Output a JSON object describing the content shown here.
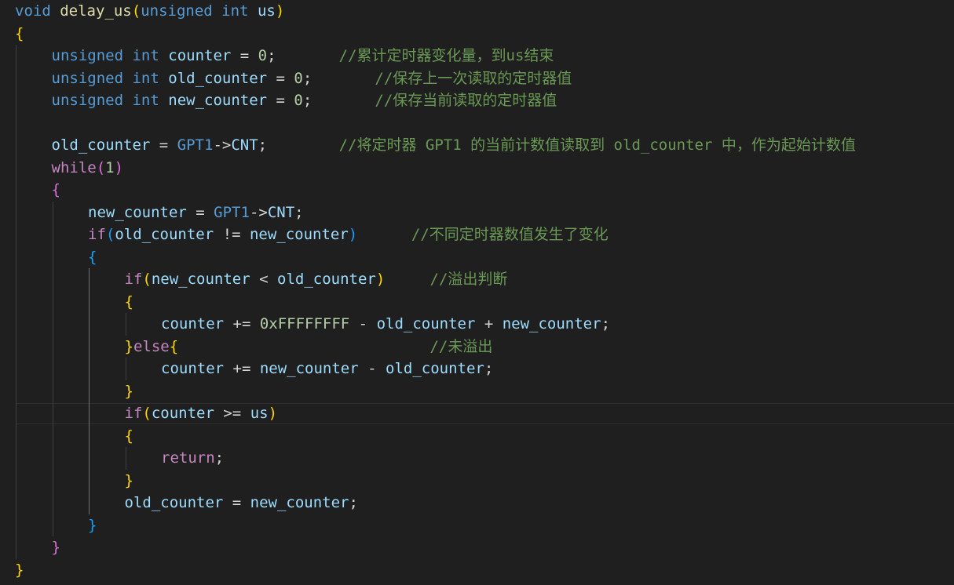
{
  "colors": {
    "background": "#1f1f1f",
    "keyword": "#569cd6",
    "control": "#c586c0",
    "function": "#dcdcaa",
    "variable": "#9cdcfe",
    "number": "#b5cea8",
    "comment": "#6a9955",
    "default": "#d4d4d4",
    "bracket_gold": "#ffd700",
    "bracket_purple": "#da70d6",
    "bracket_blue": "#179fff",
    "indent_guide": "#404040",
    "indent_guide_active": "#707070",
    "current_line_border": "#2e2e2e"
  },
  "code": {
    "lines": [
      {
        "indent": 0,
        "tokens": [
          [
            "void",
            "keyword"
          ],
          [
            " ",
            "default"
          ],
          [
            "delay_us",
            "function"
          ],
          [
            "(",
            "bracket_gold"
          ],
          [
            "unsigned",
            "keyword"
          ],
          [
            " ",
            "default"
          ],
          [
            "int",
            "keyword"
          ],
          [
            " ",
            "default"
          ],
          [
            "us",
            "variable"
          ],
          [
            ")",
            "bracket_gold"
          ]
        ]
      },
      {
        "indent": 0,
        "tokens": [
          [
            "{",
            "bracket_gold"
          ]
        ]
      },
      {
        "indent": 1,
        "tokens": [
          [
            "unsigned",
            "keyword"
          ],
          [
            " ",
            "default"
          ],
          [
            "int",
            "keyword"
          ],
          [
            " ",
            "default"
          ],
          [
            "counter",
            "variable"
          ],
          [
            " = ",
            "default"
          ],
          [
            "0",
            "number"
          ],
          [
            ";       ",
            "default"
          ],
          [
            "//累计定时器变化量，到us结束",
            "comment"
          ]
        ]
      },
      {
        "indent": 1,
        "tokens": [
          [
            "unsigned",
            "keyword"
          ],
          [
            " ",
            "default"
          ],
          [
            "int",
            "keyword"
          ],
          [
            " ",
            "default"
          ],
          [
            "old_counter",
            "variable"
          ],
          [
            " = ",
            "default"
          ],
          [
            "0",
            "number"
          ],
          [
            ";       ",
            "default"
          ],
          [
            "//保存上一次读取的定时器值",
            "comment"
          ]
        ]
      },
      {
        "indent": 1,
        "tokens": [
          [
            "unsigned",
            "keyword"
          ],
          [
            " ",
            "default"
          ],
          [
            "int",
            "keyword"
          ],
          [
            " ",
            "default"
          ],
          [
            "new_counter",
            "variable"
          ],
          [
            " = ",
            "default"
          ],
          [
            "0",
            "number"
          ],
          [
            ";       ",
            "default"
          ],
          [
            "//保存当前读取的定时器值",
            "comment"
          ]
        ]
      },
      {
        "indent": 1,
        "tokens": []
      },
      {
        "indent": 1,
        "tokens": [
          [
            "old_counter",
            "variable"
          ],
          [
            " = ",
            "default"
          ],
          [
            "GPT1",
            "keyword"
          ],
          [
            "->",
            "default"
          ],
          [
            "CNT",
            "variable"
          ],
          [
            ";        ",
            "default"
          ],
          [
            "//将定时器 GPT1 的当前计数值读取到 old_counter 中，作为起始计数值",
            "comment"
          ]
        ]
      },
      {
        "indent": 1,
        "tokens": [
          [
            "while",
            "control"
          ],
          [
            "(",
            "bracket_purple"
          ],
          [
            "1",
            "number"
          ],
          [
            ")",
            "bracket_purple"
          ]
        ]
      },
      {
        "indent": 1,
        "tokens": [
          [
            "{",
            "bracket_purple"
          ]
        ]
      },
      {
        "indent": 2,
        "tokens": [
          [
            "new_counter",
            "variable"
          ],
          [
            " = ",
            "default"
          ],
          [
            "GPT1",
            "keyword"
          ],
          [
            "->",
            "default"
          ],
          [
            "CNT",
            "variable"
          ],
          [
            ";",
            "default"
          ]
        ]
      },
      {
        "indent": 2,
        "tokens": [
          [
            "if",
            "control"
          ],
          [
            "(",
            "bracket_blue"
          ],
          [
            "old_counter",
            "variable"
          ],
          [
            " != ",
            "default"
          ],
          [
            "new_counter",
            "variable"
          ],
          [
            ")",
            "bracket_blue"
          ],
          [
            "      ",
            "default"
          ],
          [
            "//不同定时器数值发生了变化",
            "comment"
          ]
        ]
      },
      {
        "indent": 2,
        "tokens": [
          [
            "{",
            "bracket_blue"
          ]
        ]
      },
      {
        "indent": 3,
        "tokens": [
          [
            "if",
            "control"
          ],
          [
            "(",
            "bracket_gold"
          ],
          [
            "new_counter",
            "variable"
          ],
          [
            " < ",
            "default"
          ],
          [
            "old_counter",
            "variable"
          ],
          [
            ")",
            "bracket_gold"
          ],
          [
            "     ",
            "default"
          ],
          [
            "//溢出判断",
            "comment"
          ]
        ]
      },
      {
        "indent": 3,
        "tokens": [
          [
            "{",
            "bracket_gold"
          ]
        ]
      },
      {
        "indent": 4,
        "tokens": [
          [
            "counter",
            "variable"
          ],
          [
            " += ",
            "default"
          ],
          [
            "0xFFFFFFFF",
            "number"
          ],
          [
            " - ",
            "default"
          ],
          [
            "old_counter",
            "variable"
          ],
          [
            " + ",
            "default"
          ],
          [
            "new_counter",
            "variable"
          ],
          [
            ";",
            "default"
          ]
        ]
      },
      {
        "indent": 3,
        "tokens": [
          [
            "}",
            "bracket_gold"
          ],
          [
            "else",
            "control"
          ],
          [
            "{",
            "bracket_gold"
          ],
          [
            "                            ",
            "default"
          ],
          [
            "//未溢出",
            "comment"
          ]
        ]
      },
      {
        "indent": 4,
        "tokens": [
          [
            "counter",
            "variable"
          ],
          [
            " += ",
            "default"
          ],
          [
            "new_counter",
            "variable"
          ],
          [
            " - ",
            "default"
          ],
          [
            "old_counter",
            "variable"
          ],
          [
            ";",
            "default"
          ]
        ]
      },
      {
        "indent": 3,
        "tokens": [
          [
            "}",
            "bracket_gold"
          ]
        ]
      },
      {
        "indent": 3,
        "tokens": [
          [
            "if",
            "control"
          ],
          [
            "(",
            "bracket_gold"
          ],
          [
            "counter",
            "variable"
          ],
          [
            " >= ",
            "default"
          ],
          [
            "us",
            "variable"
          ],
          [
            ")",
            "bracket_gold"
          ]
        ]
      },
      {
        "indent": 3,
        "tokens": [
          [
            "{",
            "bracket_gold"
          ]
        ]
      },
      {
        "indent": 4,
        "tokens": [
          [
            "return",
            "control"
          ],
          [
            ";",
            "default"
          ]
        ]
      },
      {
        "indent": 3,
        "tokens": [
          [
            "}",
            "bracket_gold"
          ]
        ]
      },
      {
        "indent": 3,
        "tokens": [
          [
            "old_counter",
            "variable"
          ],
          [
            " = ",
            "default"
          ],
          [
            "new_counter",
            "variable"
          ],
          [
            ";",
            "default"
          ]
        ]
      },
      {
        "indent": 2,
        "tokens": [
          [
            "}",
            "bracket_blue"
          ]
        ]
      },
      {
        "indent": 1,
        "tokens": [
          [
            "}",
            "bracket_purple"
          ]
        ]
      },
      {
        "indent": 0,
        "tokens": [
          [
            "}",
            "bracket_gold"
          ]
        ]
      }
    ]
  }
}
